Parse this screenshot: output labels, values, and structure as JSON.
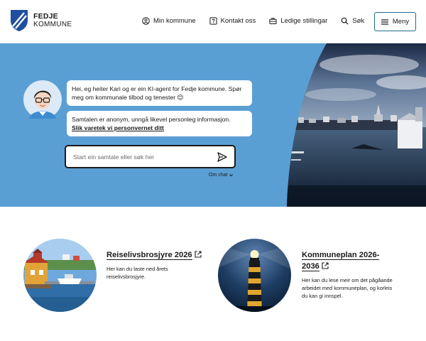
{
  "logo": {
    "line1": "FEDJE",
    "line2": "KOMMUNE"
  },
  "nav": {
    "items": [
      {
        "label": "Min kommune",
        "icon": "user-circle-icon"
      },
      {
        "label": "Kontakt oss",
        "icon": "question-icon"
      },
      {
        "label": "Ledige stillingar",
        "icon": "briefcase-icon"
      },
      {
        "label": "Søk",
        "icon": "search-icon"
      }
    ],
    "menu_label": "Meny"
  },
  "hero": {
    "bubble1": "Hei, eg heiter Kari og er ein KI-agent for Fedje kommune. Spør meg om kommunale tilbod og tenester 😊",
    "bubble2_text": "Samtalen er anonym, unngå likevel personleg informasjon.",
    "bubble2_link": "Slik varetek vi personvernet ditt",
    "search_placeholder": "Start ein samtale eller søk her",
    "about_chat": "Om chat"
  },
  "cards": [
    {
      "title": "Reiselivsbrosjyre 2026",
      "description": "Her kan du laste ned årets reiselivsbrosjyre."
    },
    {
      "title": "Kommuneplan 2026-2036",
      "description": "Her kan du lese meir om det pågåande arbeidet med kommuneplan, og korleis du kan gi innspel."
    }
  ],
  "colors": {
    "hero_bg": "#5a9fd3",
    "accent": "#1b6e8f",
    "text": "#1a1a1a"
  }
}
